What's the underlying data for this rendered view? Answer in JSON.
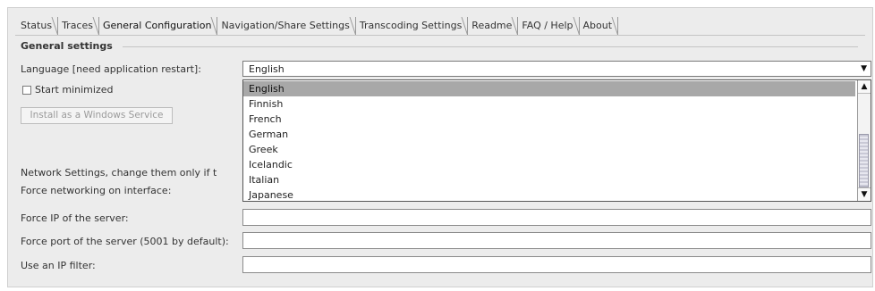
{
  "tabs": [
    "Status",
    "Traces",
    "General Configuration",
    "Navigation/Share Settings",
    "Transcoding Settings",
    "Readme",
    "FAQ / Help",
    "About"
  ],
  "general": {
    "title": "General settings",
    "language_label": "Language [need application restart]:",
    "language_value": "English",
    "language_options": [
      "English",
      "Finnish",
      "French",
      "German",
      "Greek",
      "Icelandic",
      "Italian",
      "Japanese"
    ],
    "start_minimized_label": "Start minimized",
    "install_service_label": "Install as a Windows Service"
  },
  "network": {
    "title": "Network Settings, change them only if t",
    "force_interface_label": "Force networking on interface:",
    "force_ip_label": "Force IP of the server:",
    "force_port_label": "Force port of the server (5001 by default):",
    "ip_filter_label": "Use an IP filter:"
  },
  "icons": {
    "dropdown_arrow": "▼",
    "scroll_up": "▲",
    "scroll_down": "▼"
  }
}
